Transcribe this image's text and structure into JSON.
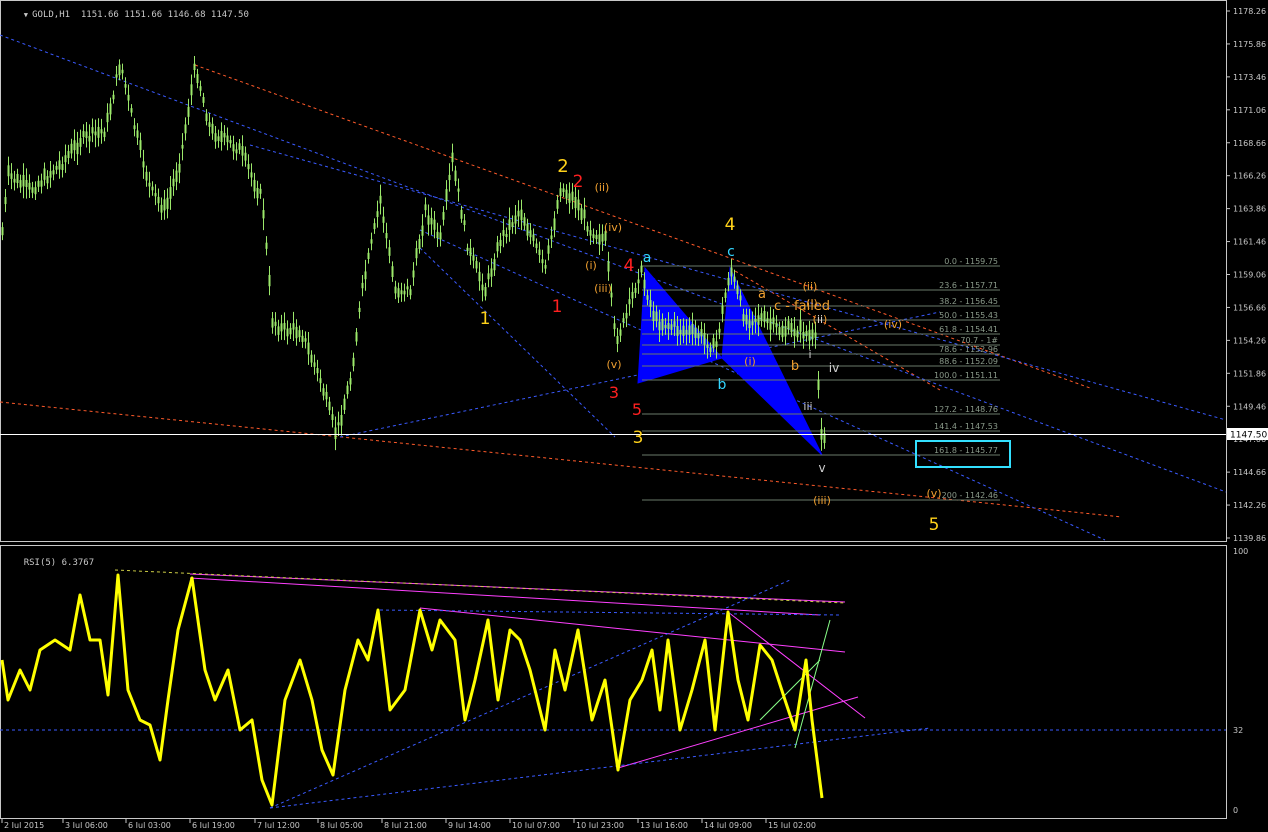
{
  "window": {
    "main_title": "GOLD,H1  1151.66 1151.66 1146.68 1147.50",
    "rsi_title": "RSI(5) 6.3767"
  },
  "colors": {
    "background": "#000000",
    "bull_candle": "#9be86a",
    "axis": "#c8c8c8",
    "price_line": "#ffffff",
    "harmonic_fill": "#0000ff",
    "fib_line": "#6a7a6a",
    "trend_red": "#ff5a2a",
    "trend_blue": "#3a5aff",
    "rsi_line": "#ffff00",
    "rsi_trend_magenta": "#ff40ff",
    "rsi_trend_green": "#88ff88",
    "target_box": "#33e0ff",
    "wave_yellow": "#ffd21a",
    "wave_red": "#ff2020",
    "wave_cyan": "#33d6ff",
    "wave_orange": "#f0a030"
  },
  "price_axis": {
    "ticks": [
      "1178.26",
      "1175.86",
      "1173.46",
      "1171.06",
      "1168.66",
      "1166.26",
      "1163.86",
      "1161.46",
      "1159.06",
      "1156.66",
      "1154.26",
      "1151.86",
      "1149.46",
      "1147.06",
      "1144.66",
      "1142.26",
      "1139.86"
    ],
    "current_price": "1147.50"
  },
  "rsi_axis": {
    "ticks": [
      "100",
      "32",
      "0"
    ]
  },
  "time_axis": {
    "labels": [
      "2 Jul 2015",
      "3 Jul 06:00",
      "6 Jul 03:00",
      "6 Jul 19:00",
      "7 Jul 12:00",
      "8 Jul 05:00",
      "8 Jul 21:00",
      "9 Jul 14:00",
      "10 Jul 07:00",
      "10 Jul 23:00",
      "13 Jul 16:00",
      "14 Jul 09:00",
      "15 Jul 02:00"
    ]
  },
  "fib_levels": [
    "0.0 - 1159.75",
    "23.6 - 1157.71",
    "38.2 - 1156.45",
    "50.0 - 1155.43",
    "61.8 - 1154.41",
    "70.7 - 1#",
    "78.6 - 1152.96",
    "88.6 - 1152.09",
    "100.0 - 1151.11",
    "127.2 - 1148.76",
    "141.4 - 1147.53",
    "161.8 - 1145.77",
    "200 - 1142.46"
  ],
  "wave_labels": [
    {
      "text": "1",
      "color": "yellow"
    },
    {
      "text": "2",
      "color": "yellow"
    },
    {
      "text": "3",
      "color": "yellow"
    },
    {
      "text": "4",
      "color": "yellow"
    },
    {
      "text": "5",
      "color": "yellow"
    },
    {
      "text": "1",
      "color": "red"
    },
    {
      "text": "2",
      "color": "red"
    },
    {
      "text": "3",
      "color": "red"
    },
    {
      "text": "4",
      "color": "red"
    },
    {
      "text": "5",
      "color": "red"
    },
    {
      "text": "a",
      "color": "cyan"
    },
    {
      "text": "b",
      "color": "cyan"
    },
    {
      "text": "c",
      "color": "cyan"
    },
    {
      "text": "(i)",
      "color": "orange"
    },
    {
      "text": "(ii)",
      "color": "orange"
    },
    {
      "text": "(iii)",
      "color": "orange"
    },
    {
      "text": "(iv)",
      "color": "orange"
    },
    {
      "text": "(v)",
      "color": "orange"
    },
    {
      "text": "(i)",
      "color": "orange"
    },
    {
      "text": "(ii)",
      "color": "orange"
    },
    {
      "text": "(iii)",
      "color": "orange"
    },
    {
      "text": "(iv)",
      "color": "orange"
    },
    {
      "text": "(v)",
      "color": "orange"
    },
    {
      "text": "(i)",
      "color": "orange"
    },
    {
      "text": "(ii)",
      "color": "orange"
    },
    {
      "text": "a",
      "color": "orange"
    },
    {
      "text": "b",
      "color": "orange"
    },
    {
      "text": "c - failed",
      "color": "orange"
    },
    {
      "text": "i",
      "color": "white"
    },
    {
      "text": "ii",
      "color": "white"
    },
    {
      "text": "iii",
      "color": "white"
    },
    {
      "text": "iv",
      "color": "white"
    },
    {
      "text": "v",
      "color": "white"
    }
  ],
  "chart_data": [
    {
      "type": "line",
      "title": "GOLD,H1",
      "xlabel": "",
      "ylabel": "",
      "ylim": [
        1139.86,
        1179.0
      ],
      "x": [
        "2 Jul 2015",
        "3 Jul 06:00",
        "6 Jul 03:00",
        "6 Jul 19:00",
        "7 Jul 12:00",
        "8 Jul 05:00",
        "8 Jul 21:00",
        "9 Jul 14:00",
        "10 Jul 07:00",
        "10 Jul 23:00",
        "13 Jul 16:00",
        "14 Jul 09:00",
        "15 Jul 02:00"
      ],
      "series": [
        {
          "name": "",
          "values": [
            1162.0,
            1166.5,
            1166.8,
            1167.8,
            1150.5,
            1155.8,
            1156.0,
            1162.0,
            1158.0,
            1160.0,
            1155.0,
            1155.5,
            1154.8
          ]
        }
      ],
      "current": 1147.5,
      "grid": false
    },
    {
      "type": "line",
      "title": "RSI(5) 6.3767",
      "ylim": [
        0,
        100
      ],
      "levels": [
        32
      ],
      "x": [
        "2 Jul 2015",
        "3 Jul 06:00",
        "6 Jul 03:00",
        "6 Jul 19:00",
        "7 Jul 12:00",
        "8 Jul 05:00",
        "8 Jul 21:00",
        "9 Jul 14:00",
        "10 Jul 07:00",
        "10 Jul 23:00",
        "13 Jul 16:00",
        "14 Jul 09:00",
        "15 Jul 02:00"
      ],
      "series": [
        {
          "name": "",
          "values": [
            55,
            70,
            75,
            60,
            8,
            55,
            65,
            60,
            55,
            45,
            45,
            55,
            6.38
          ]
        }
      ],
      "grid": false
    }
  ]
}
